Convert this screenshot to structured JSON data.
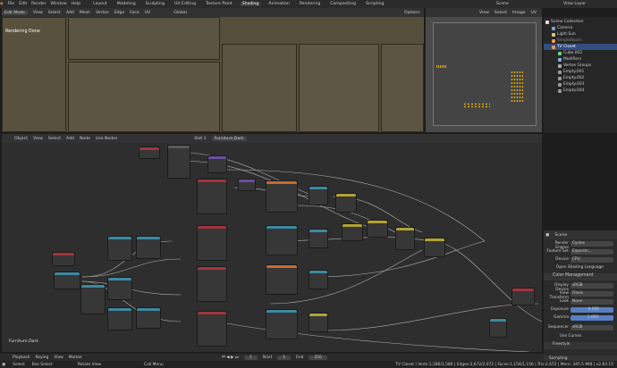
{
  "menu": {
    "items": [
      "File",
      "Edit",
      "Render",
      "Window",
      "Help"
    ],
    "tabs": [
      "Layout",
      "Modeling",
      "Sculpting",
      "UV Editing",
      "Texture Paint",
      "Shading",
      "Animation",
      "Rendering",
      "Compositing",
      "Scripting"
    ],
    "active_tab": "Shading",
    "scene": "Scene",
    "view_layer": "View Layer"
  },
  "viewport": {
    "mode": "Edit Mode",
    "menus": [
      "View",
      "Select",
      "Add",
      "Mesh",
      "Vertex",
      "Edge",
      "Face",
      "UV"
    ],
    "orientation": "Global",
    "options": "Options",
    "status": "Rendering Done"
  },
  "uv": {
    "menus": [
      "View",
      "Select",
      "Image",
      "UV"
    ]
  },
  "outliner": {
    "items": [
      "Scene Collection",
      "Camera",
      "Light.Sun",
      "SimpleRoom",
      "TV Closet",
      "Cube.002",
      "Modifiers",
      "Vertex Groups",
      "Empty.001",
      "Empty.002",
      "Empty.003",
      "Empty.004"
    ]
  },
  "node_editor": {
    "type": "Object",
    "menus": [
      "View",
      "Select",
      "Add",
      "Node"
    ],
    "use_nodes": "Use Nodes",
    "slot": "Slot 1",
    "material": "Furniture.Dark",
    "label": "Furniture.Dark"
  },
  "properties": {
    "title": "Scene",
    "render_engine_label": "Render Engine",
    "render_engine": "Cycles",
    "feature_set_label": "Feature Set",
    "feature_set": "Experim...",
    "device_label": "Device",
    "device": "CPU",
    "osl": "Open Shading Language",
    "color_mgmt": "Color Management",
    "display_device_label": "Display Device",
    "display_device": "sRGB",
    "view_transform_label": "View Transform",
    "view_transform": "Filmic",
    "look_label": "Look",
    "look": "None",
    "exposure_label": "Exposure",
    "exposure": "-3.000",
    "gamma_label": "Gamma",
    "gamma": "1.000",
    "sequencer_label": "Sequencer",
    "sequencer": "sRGB",
    "curves": "Use Curves",
    "freestyle": "Freestyle",
    "sampling": "Sampling"
  },
  "playback": {
    "items": [
      "Playback",
      "Keying",
      "View",
      "Marker"
    ],
    "frame": "1",
    "start_label": "Start",
    "start": "1",
    "end_label": "End",
    "end": "250"
  },
  "status": {
    "left": [
      "Select",
      "Box Select",
      "Rotate View",
      "Call Menu"
    ],
    "right": "TV Closet | Verts:1,586/1,586 | Edges:2,672/2,672 | Faces:1,156/1,156 | Tris:2,672 | Mem: 345.5 MiB | v2.83.15"
  }
}
